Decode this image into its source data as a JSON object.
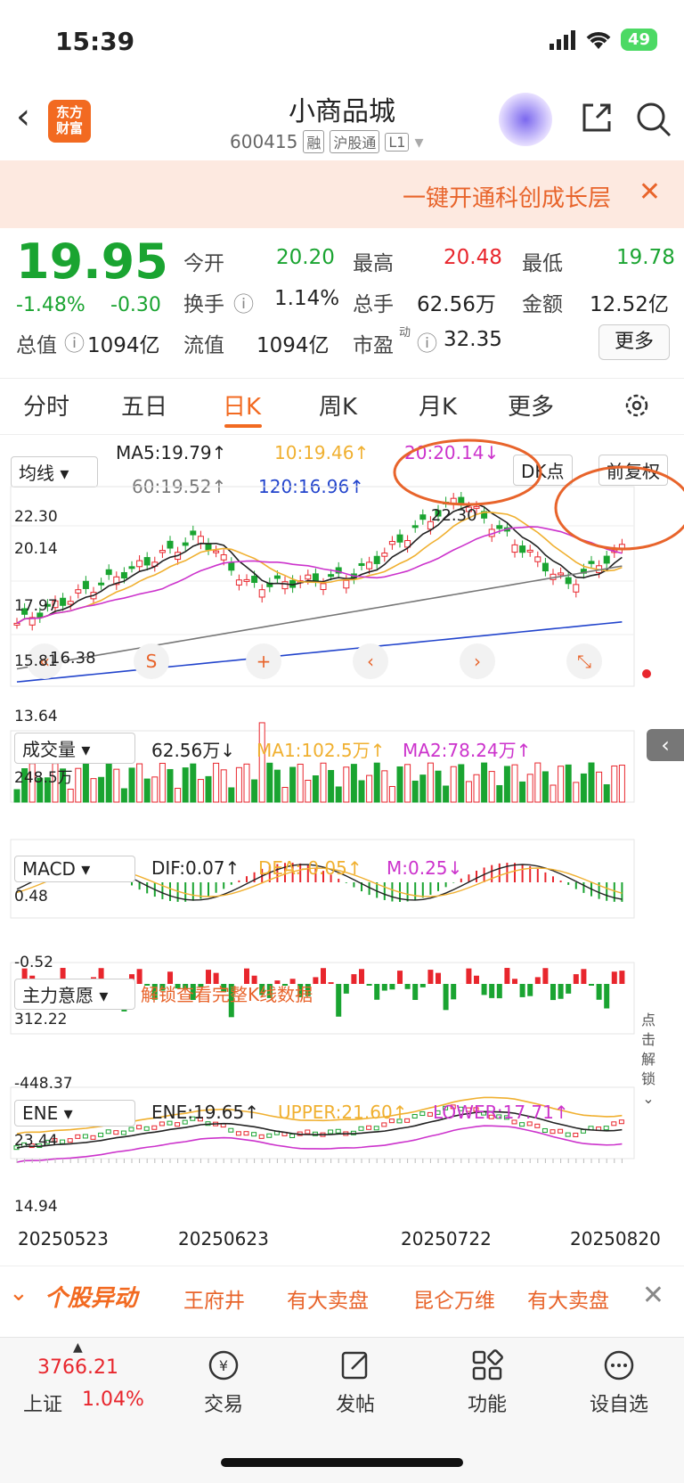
{
  "status": {
    "time": "15:39",
    "battery": "49"
  },
  "header": {
    "name": "小商品城",
    "code": "600415",
    "tags": [
      "融",
      "沪股通",
      "L1"
    ],
    "logo": "东方财富"
  },
  "banner": {
    "text": "一键开通科创成长层"
  },
  "quote": {
    "price": "19.95",
    "change_pct": "-1.48%",
    "change": "-0.30",
    "open_label": "今开",
    "open": "20.20",
    "high_label": "最高",
    "high": "20.48",
    "low_label": "最低",
    "low": "19.78",
    "turnover_label": "换手",
    "turnover": "1.14%",
    "volume_label": "总手",
    "volume": "62.56万",
    "amount_label": "金额",
    "amount": "12.52亿",
    "mktcap_label": "总值",
    "mktcap": "1094亿",
    "float_label": "流值",
    "float": "1094亿",
    "pe_label": "市盈",
    "pe_sup": "动",
    "pe": "32.35",
    "more": "更多"
  },
  "tabs": [
    "分时",
    "五日",
    "日K",
    "周K",
    "月K",
    "更多"
  ],
  "kline": {
    "selector": "均线",
    "ma5": "MA5:19.79↑",
    "ma10": "10:19.46↑",
    "ma20": "20:20.14↓",
    "ma60": "60:19.52↑",
    "ma120": "120:16.96↑",
    "dk": "DK点",
    "adjust": "前复权",
    "y_high": "22.30",
    "y_mid1": "20.14",
    "y_mid2": "17.97",
    "y_low1": "15.81",
    "y_low2": "13.64",
    "peak": "22.30",
    "trough": "16.38"
  },
  "volume": {
    "selector": "成交量",
    "value": "62.56万↓",
    "ma1": "MA1:102.5万↑",
    "ma2": "MA2:78.24万↑",
    "max": "248.5万"
  },
  "macd": {
    "selector": "MACD",
    "dif": "DIF:0.07↑",
    "dea": "DEA:-0.05↑",
    "m": "M:0.25↓",
    "top": "0.48",
    "bottom": "-0.52"
  },
  "main_force": {
    "selector": "主力意愿",
    "unlock": "解锁查看完整K线数据",
    "top": "312.22",
    "bottom": "-448.37",
    "side": "点击解锁"
  },
  "ene": {
    "selector": "ENE",
    "ene": "ENE:19.65↑",
    "upper": "UPPER:21.60↑",
    "lower": "LOWER:17.71↑",
    "top": "23.44",
    "bottom": "14.94"
  },
  "dates": [
    "20250523",
    "20250623",
    "20250722",
    "20250820"
  ],
  "news": {
    "title": "个股异动",
    "items": [
      "王府井",
      "有大卖盘",
      "昆仑万维",
      "有大卖盘"
    ]
  },
  "bottom": {
    "index_value": "3766.21",
    "index_name": "上证",
    "index_pct": "1.04%",
    "items": [
      "交易",
      "发帖",
      "功能",
      "设自选"
    ]
  },
  "colors": {
    "up": "#e8262d",
    "down": "#1aa431",
    "accent": "#f26a21"
  }
}
